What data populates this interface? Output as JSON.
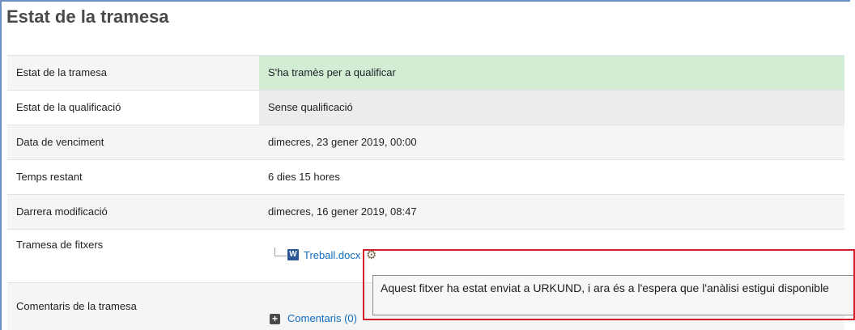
{
  "page": {
    "heading": "Estat de la tramesa"
  },
  "rows": [
    {
      "label": "Estat de la tramesa",
      "value": "S'ha tramès per a qualificar"
    },
    {
      "label": "Estat de la qualificació",
      "value": "Sense qualificació"
    },
    {
      "label": "Data de venciment",
      "value": "dimecres, 23 gener 2019, 00:00"
    },
    {
      "label": "Temps restant",
      "value": "6 dies 15 hores"
    },
    {
      "label": "Darrera modificació",
      "value": "dimecres, 16 gener 2019, 08:47"
    },
    {
      "label": "Tramesa de fitxers"
    },
    {
      "label": "Comentaris de la tramesa"
    }
  ],
  "file": {
    "icon_text": "W",
    "name": "Treball.docx",
    "icon": "word-document-icon",
    "status_icon": "gear-icon"
  },
  "tooltip": {
    "text": "Aquest fitxer ha estat enviat a URKUND, i ara és a l'espera que l'anàlisi estigui disponible"
  },
  "comments": {
    "label": "Comentaris (0)",
    "icon": "plus-icon"
  },
  "colors": {
    "submitted_status": "#d3edd5",
    "grade_status": "#ececec",
    "highlight": "#d11f2b",
    "link": "#0f6cbf"
  }
}
